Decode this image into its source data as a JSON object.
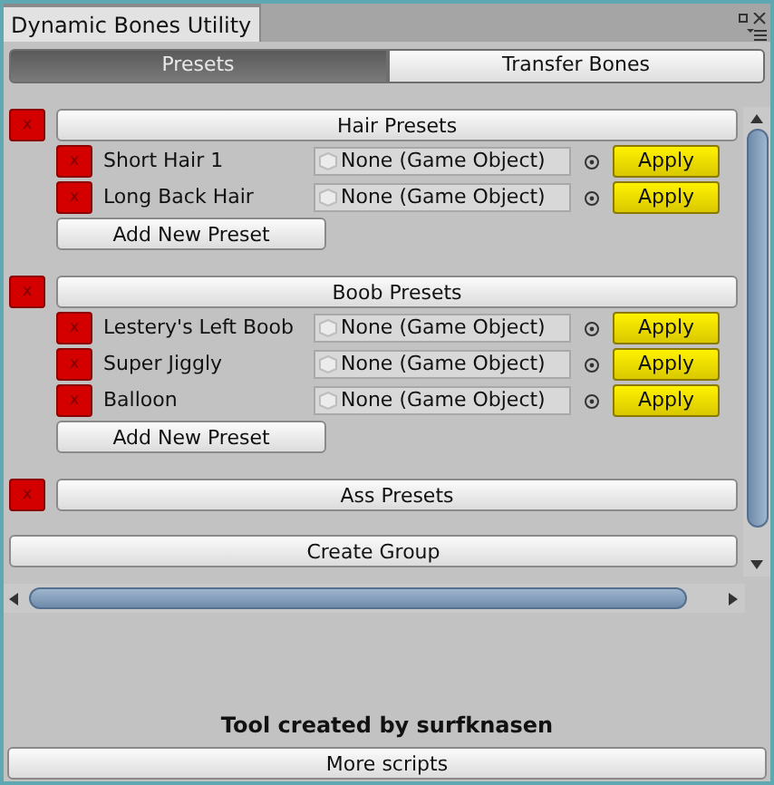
{
  "window": {
    "title": "Dynamic Bones Utility"
  },
  "tabs": [
    {
      "label": "Presets",
      "selected": true
    },
    {
      "label": "Transfer Bones",
      "selected": false
    }
  ],
  "groups": [
    {
      "delete_label": "x",
      "title": "Hair Presets",
      "presets": [
        {
          "delete_label": "x",
          "name": "Short Hair 1",
          "object_field": "None (Game Object)",
          "apply_label": "Apply"
        },
        {
          "delete_label": "x",
          "name": "Long Back Hair",
          "object_field": "None (Game Object)",
          "apply_label": "Apply"
        }
      ],
      "add_label": "Add New Preset"
    },
    {
      "delete_label": "x",
      "title": "Boob Presets",
      "presets": [
        {
          "delete_label": "x",
          "name": "Lestery's Left Boob",
          "object_field": "None (Game Object)",
          "apply_label": "Apply"
        },
        {
          "delete_label": "x",
          "name": "Super Jiggly",
          "object_field": "None (Game Object)",
          "apply_label": "Apply"
        },
        {
          "delete_label": "x",
          "name": "Balloon",
          "object_field": "None (Game Object)",
          "apply_label": "Apply"
        }
      ],
      "add_label": "Add New Preset"
    },
    {
      "delete_label": "x",
      "title": "Ass Presets"
    }
  ],
  "create_group": "Create Group",
  "credit": "Tool created by surfknasen",
  "more_scripts": "More scripts"
}
